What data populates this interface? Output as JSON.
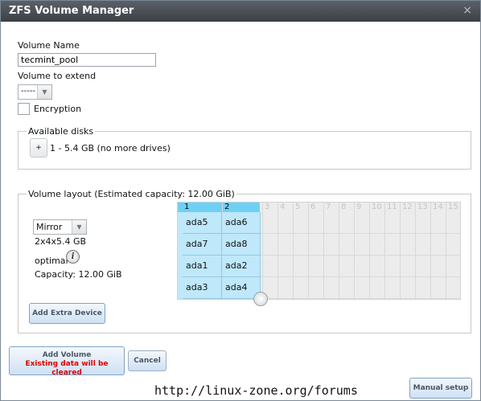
{
  "dialog": {
    "title": "ZFS Volume Manager",
    "close_glyph": "×"
  },
  "form": {
    "volume_name_label": "Volume Name",
    "volume_name_value": "tecmint_pool",
    "volume_to_extend_label": "Volume to extend",
    "volume_to_extend_value": "-----",
    "encryption_label": "Encryption",
    "encryption_checked": false
  },
  "available_disks": {
    "legend": "Available disks",
    "add_glyph": "+",
    "summary": "1 - 5.4 GB (no more drives)"
  },
  "volume_layout": {
    "legend": "Volume layout (Estimated capacity: 12.00 GiB)",
    "layout_type": "Mirror",
    "disk_config": "2x4x5.4 GB",
    "status": "optimal",
    "capacity": "Capacity: 12.00 GiB",
    "add_extra_device_label": "Add Extra Device",
    "columns": [
      "1",
      "2",
      "3",
      "4",
      "5",
      "6",
      "7",
      "8",
      "9",
      "10",
      "11",
      "12",
      "13",
      "14",
      "15"
    ],
    "active_columns": 2,
    "rows": [
      [
        "ada5",
        "ada6"
      ],
      [
        "ada7",
        "ada8"
      ],
      [
        "ada1",
        "ada2"
      ],
      [
        "ada3",
        "ada4"
      ]
    ]
  },
  "buttons": {
    "add_volume": "Add Volume",
    "add_volume_warning": "Existing data will be cleared",
    "cancel": "Cancel",
    "manual_setup": "Manual setup"
  },
  "watermark": "http://linux-zone.org/forums",
  "colors": {
    "title_bar": "#474c52",
    "disk_cell": "#bfe8fa",
    "header_active": "#6fd0f5",
    "warning": "#dd0000"
  }
}
